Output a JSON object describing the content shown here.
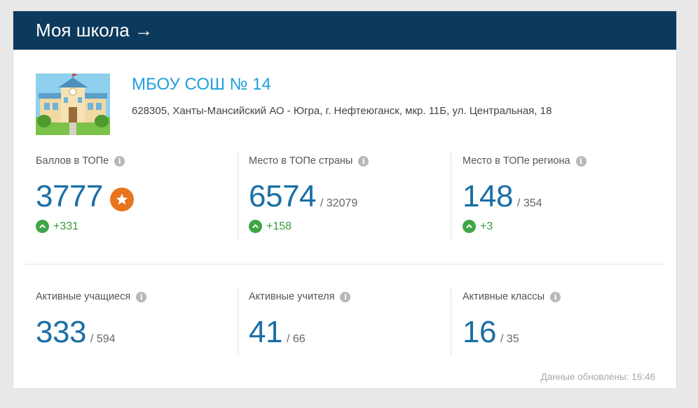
{
  "header": {
    "title": "Моя школа →"
  },
  "school": {
    "name": "МБОУ СОШ № 14",
    "address": "628305, Ханты-Мансийский АО - Югра, г. Нефтеюганск, мкр. 11Б, ул. Центральная, 18",
    "image_icon": "school-building-icon"
  },
  "top_stats": [
    {
      "label": "Баллов в ТОПе",
      "value": "3777",
      "total": "",
      "delta": "+331",
      "badge_icon": "star-badge-icon"
    },
    {
      "label": "Место в ТОПе страны",
      "value": "6574",
      "total": "/ 32079",
      "delta": "+158"
    },
    {
      "label": "Место в ТОПе региона",
      "value": "148",
      "total": "/ 354",
      "delta": "+3"
    }
  ],
  "bottom_stats": [
    {
      "label": "Активные учащиеся",
      "value": "333",
      "total": "/ 594"
    },
    {
      "label": "Активные учителя",
      "value": "41",
      "total": "/ 66"
    },
    {
      "label": "Активные классы",
      "value": "16",
      "total": "/ 35"
    }
  ],
  "info_glyph": "i",
  "footer": {
    "updated": "Данные обновлены: 16:46"
  },
  "colors": {
    "header_bg": "#0d3a5c",
    "link": "#1f9fdc",
    "value": "#1a6fa6",
    "delta": "#3b9a3d",
    "badge": "#e8741c"
  }
}
